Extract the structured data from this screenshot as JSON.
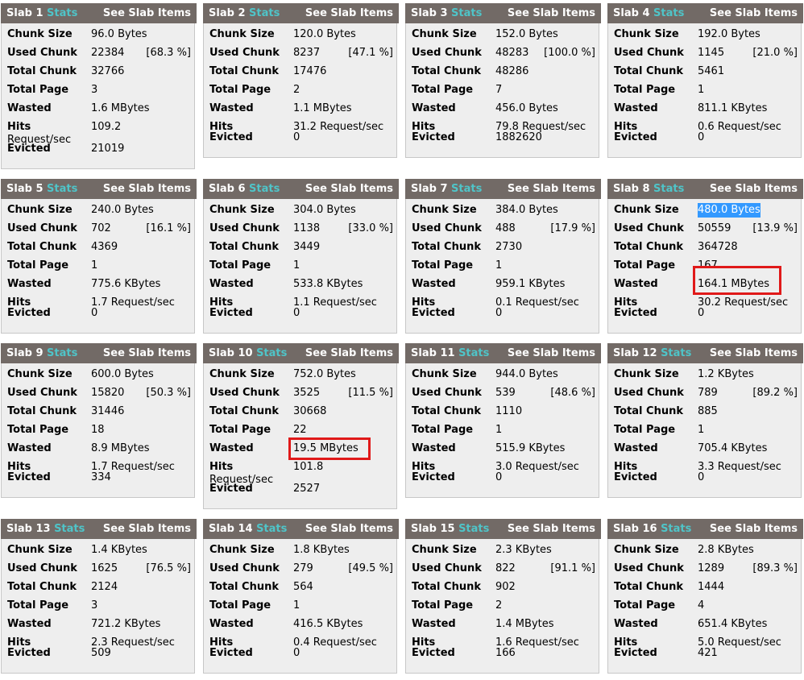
{
  "labels": {
    "slab": "Slab",
    "stats": "Stats",
    "see_items": "See Slab Items",
    "chunk_size": "Chunk Size",
    "used_chunk": "Used Chunk",
    "total_chunk": "Total Chunk",
    "total_page": "Total Page",
    "wasted": "Wasted",
    "hits": "Hits",
    "evicted": "Evicted",
    "req_unit": "Request/sec"
  },
  "colors": {
    "header_bg": "#726a66",
    "stats_link": "#4fc4c8",
    "panel_bg": "#eeeeee",
    "highlight_box": "#e01919",
    "selection": "#3399ff"
  },
  "slabs": [
    {
      "num": "1",
      "chunk_size": "96.0 Bytes",
      "used_chunk": "22384",
      "used_pct": "[68.3 %]",
      "total_chunk": "32766",
      "total_page": "3",
      "wasted": "1.6 MBytes",
      "hits": "109.2",
      "hits_wrap": true,
      "evicted": "21019"
    },
    {
      "num": "2",
      "chunk_size": "120.0 Bytes",
      "used_chunk": "8237",
      "used_pct": "[47.1 %]",
      "total_chunk": "17476",
      "total_page": "2",
      "wasted": "1.1 MBytes",
      "hits": "31.2 Request/sec",
      "hits_wrap": false,
      "evicted": "0"
    },
    {
      "num": "3",
      "chunk_size": "152.0 Bytes",
      "used_chunk": "48283",
      "used_pct": "[100.0 %]",
      "total_chunk": "48286",
      "total_page": "7",
      "wasted": "456.0 Bytes",
      "hits": "79.8 Request/sec",
      "hits_wrap": false,
      "evicted": "1882620"
    },
    {
      "num": "4",
      "chunk_size": "192.0 Bytes",
      "used_chunk": "1145",
      "used_pct": "[21.0 %]",
      "total_chunk": "5461",
      "total_page": "1",
      "wasted": "811.1 KBytes",
      "hits": "0.6 Request/sec",
      "hits_wrap": false,
      "evicted": "0"
    },
    {
      "num": "5",
      "chunk_size": "240.0 Bytes",
      "used_chunk": "702",
      "used_pct": "[16.1 %]",
      "total_chunk": "4369",
      "total_page": "1",
      "wasted": "775.6 KBytes",
      "hits": "1.7 Request/sec",
      "hits_wrap": false,
      "evicted": "0"
    },
    {
      "num": "6",
      "chunk_size": "304.0 Bytes",
      "used_chunk": "1138",
      "used_pct": "[33.0 %]",
      "total_chunk": "3449",
      "total_page": "1",
      "wasted": "533.8 KBytes",
      "hits": "1.1 Request/sec",
      "hits_wrap": false,
      "evicted": "0"
    },
    {
      "num": "7",
      "chunk_size": "384.0 Bytes",
      "used_chunk": "488",
      "used_pct": "[17.9 %]",
      "total_chunk": "2730",
      "total_page": "1",
      "wasted": "959.1 KBytes",
      "hits": "0.1 Request/sec",
      "hits_wrap": false,
      "evicted": "0"
    },
    {
      "num": "8",
      "chunk_size": "480.0 Bytes",
      "chunk_highlight": true,
      "used_chunk": "50559",
      "used_pct": "[13.9 %]",
      "total_chunk": "364728",
      "total_page": "167",
      "wasted": "164.1 MBytes",
      "wasted_boxed": true,
      "hits": "30.2 Request/sec",
      "hits_wrap": false,
      "evicted": "0"
    },
    {
      "num": "9",
      "chunk_size": "600.0 Bytes",
      "used_chunk": "15820",
      "used_pct": "[50.3 %]",
      "total_chunk": "31446",
      "total_page": "18",
      "wasted": "8.9 MBytes",
      "hits": "1.7 Request/sec",
      "hits_wrap": false,
      "evicted": "334"
    },
    {
      "num": "10",
      "chunk_size": "752.0 Bytes",
      "used_chunk": "3525",
      "used_pct": "[11.5 %]",
      "total_chunk": "30668",
      "total_page": "22",
      "wasted": "19.5 MBytes",
      "wasted_boxed": true,
      "hits": "101.8",
      "hits_wrap": true,
      "evicted": "2527"
    },
    {
      "num": "11",
      "chunk_size": "944.0 Bytes",
      "used_chunk": "539",
      "used_pct": "[48.6 %]",
      "total_chunk": "1110",
      "total_page": "1",
      "wasted": "515.9 KBytes",
      "hits": "3.0 Request/sec",
      "hits_wrap": false,
      "evicted": "0"
    },
    {
      "num": "12",
      "chunk_size": "1.2 KBytes",
      "used_chunk": "789",
      "used_pct": "[89.2 %]",
      "total_chunk": "885",
      "total_page": "1",
      "wasted": "705.4 KBytes",
      "hits": "3.3 Request/sec",
      "hits_wrap": false,
      "evicted": "0"
    },
    {
      "num": "13",
      "chunk_size": "1.4 KBytes",
      "used_chunk": "1625",
      "used_pct": "[76.5 %]",
      "total_chunk": "2124",
      "total_page": "3",
      "wasted": "721.2 KBytes",
      "hits": "2.3 Request/sec",
      "hits_wrap": false,
      "evicted": "509"
    },
    {
      "num": "14",
      "chunk_size": "1.8 KBytes",
      "used_chunk": "279",
      "used_pct": "[49.5 %]",
      "total_chunk": "564",
      "total_page": "1",
      "wasted": "416.5 KBytes",
      "hits": "0.4 Request/sec",
      "hits_wrap": false,
      "evicted": "0"
    },
    {
      "num": "15",
      "chunk_size": "2.3 KBytes",
      "used_chunk": "822",
      "used_pct": "[91.1 %]",
      "total_chunk": "902",
      "total_page": "2",
      "wasted": "1.4 MBytes",
      "hits": "1.6 Request/sec",
      "hits_wrap": false,
      "evicted": "166"
    },
    {
      "num": "16",
      "chunk_size": "2.8 KBytes",
      "used_chunk": "1289",
      "used_pct": "[89.3 %]",
      "total_chunk": "1444",
      "total_page": "4",
      "wasted": "651.4 KBytes",
      "hits": "5.0 Request/sec",
      "hits_wrap": false,
      "evicted": "421"
    }
  ]
}
